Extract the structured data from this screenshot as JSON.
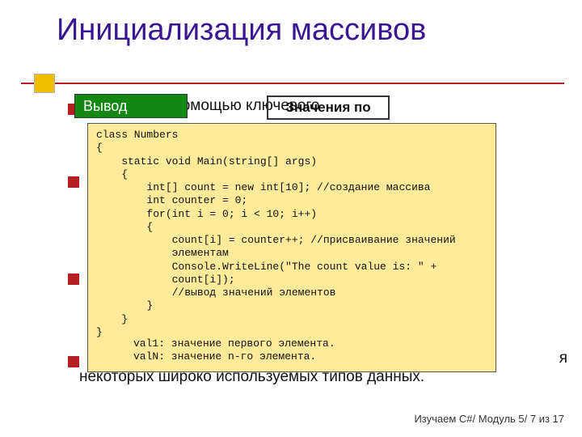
{
  "title": "Инициализация массивов",
  "badge_output": "Вывод",
  "badge_defaults": "Значения по",
  "bg_line1": "ть создан с помощью ключевого",
  "bg_line4": "я",
  "bg_line5": "некоторых широко используемых типов данных.",
  "subtext1": "val1: значение первого элемента.",
  "subtext2": "valN: значение n-го элемента.",
  "footer": "Изучаем C#/ Модуль 5/ 7 из 17",
  "code": "class Numbers\n{\n    static void Main(string[] args)\n    {\n        int[] count = new int[10]; //создание массива\n        int counter = 0;\n        for(int i = 0; i < 10; i++)\n        {\n            count[i] = counter++; //присваивание значений\n            элементам\n            Console.WriteLine(\"The count value is: \" +\n            count[i]);\n            //вывод значений элементов\n        }\n    }\n}"
}
